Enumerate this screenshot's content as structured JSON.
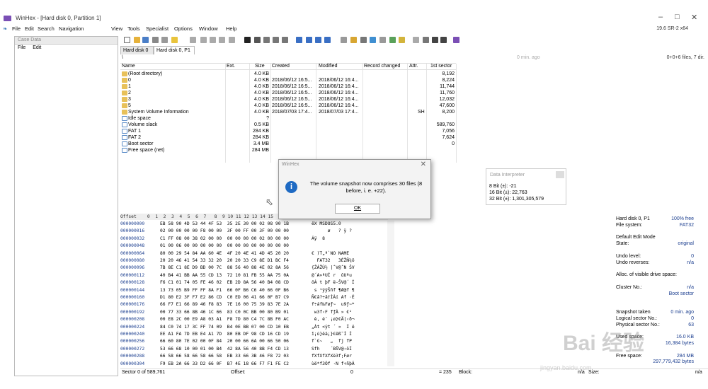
{
  "window": {
    "title": "WinHex - [Hard disk 0, Partition 1]",
    "version": "19.6 SR-2 x64"
  },
  "menu": [
    "File",
    "Edit",
    "Search",
    "Navigation",
    "View",
    "Tools",
    "Specialist",
    "Options",
    "Window",
    "Help"
  ],
  "case": {
    "header": "Case Data",
    "menu": [
      "File",
      "Edit"
    ]
  },
  "tabs": [
    "Hard disk 0",
    "Hard disk 0, P1"
  ],
  "path": {
    "left": "\\",
    "center": "0 min. ago",
    "right": "0+0+6 files, 7 dir."
  },
  "columns": {
    "name": "Name",
    "ext": "Ext.",
    "size": "Size",
    "created": "Created",
    "modified": "Modified",
    "record": "Record changed",
    "attr": "Attr.",
    "sector": "1st sector"
  },
  "files": [
    {
      "name": "(Root directory)",
      "size": "4.0 KB",
      "created": "",
      "modified": "",
      "attr": "",
      "sector": "8,192",
      "icon": "folder"
    },
    {
      "name": "0",
      "size": "4.0 KB",
      "created": "2018/06/12 16:5...",
      "modified": "2018/06/12 16:4...",
      "attr": "",
      "sector": "8,224",
      "icon": "folder"
    },
    {
      "name": "1",
      "size": "4.0 KB",
      "created": "2018/06/12 16:5...",
      "modified": "2018/06/12 16:4...",
      "attr": "",
      "sector": "11,744",
      "icon": "folder"
    },
    {
      "name": "2",
      "size": "4.0 KB",
      "created": "2018/06/12 16:5...",
      "modified": "2018/06/12 16:4...",
      "attr": "",
      "sector": "11,760",
      "icon": "folder"
    },
    {
      "name": "3",
      "size": "4.0 KB",
      "created": "2018/06/12 16:5...",
      "modified": "2018/06/12 16:4...",
      "attr": "",
      "sector": "12,032",
      "icon": "folder"
    },
    {
      "name": "5",
      "size": "4.0 KB",
      "created": "2018/06/12 16:5...",
      "modified": "2018/06/12 16:4...",
      "attr": "",
      "sector": "47,600",
      "icon": "folder"
    },
    {
      "name": "System Volume Information",
      "size": "4.0 KB",
      "created": "2018/07/03 17:4...",
      "modified": "2018/07/03 17:4...",
      "attr": "SH",
      "sector": "8,200",
      "icon": "folder"
    },
    {
      "name": "Idle space",
      "size": "?",
      "created": "",
      "modified": "",
      "attr": "",
      "sector": "",
      "icon": "file"
    },
    {
      "name": "Volume slack",
      "size": "0.5 KB",
      "created": "",
      "modified": "",
      "attr": "",
      "sector": "589,760",
      "icon": "file"
    },
    {
      "name": "FAT 1",
      "size": "284 KB",
      "created": "",
      "modified": "",
      "attr": "",
      "sector": "7,056",
      "icon": "file"
    },
    {
      "name": "FAT 2",
      "size": "284 KB",
      "created": "",
      "modified": "",
      "attr": "",
      "sector": "7,624",
      "icon": "file"
    },
    {
      "name": "Boot sector",
      "size": "3.4 MB",
      "created": "",
      "modified": "",
      "attr": "",
      "sector": "0",
      "icon": "file"
    },
    {
      "name": "Free space (net)",
      "size": "284 MB",
      "created": "",
      "modified": "",
      "attr": "",
      "sector": "",
      "icon": "file"
    }
  ],
  "dialog": {
    "title": "WinHex",
    "message": "The volume snapshot now comprises 30 files (8 before, i. e. +22).",
    "ok": "OK"
  },
  "interpreter": {
    "title": "Data Interpreter",
    "rows": [
      "8 Bit (±): -21",
      "16 Bit (±): 22,763",
      "32 Bit (±): 1,301,305,579"
    ]
  },
  "hex": {
    "header": "Offset    0  1  2  3  4  5  6  7   8  9 10 11 12 13 14 15",
    "rows": [
      {
        "off": "000000000",
        "hex": "EB 58 90 4D 53 44 4F 53  35 2E 30 00 02 08 90 1B",
        "txt": "ëX MSDOS5.0"
      },
      {
        "off": "000000016",
        "hex": "02 00 00 00 00 F8 00 00  3F 00 FF 00 3F 00 00 00",
        "txt": "      ø   ? ÿ ?"
      },
      {
        "off": "000000032",
        "hex": "C1 FF 08 00 38 02 00 00  00 00 00 00 02 00 00 00",
        "txt": "Áÿ  8"
      },
      {
        "off": "000000048",
        "hex": "01 00 06 00 00 00 00 00  00 00 00 00 00 00 00 00",
        "txt": ""
      },
      {
        "off": "000000064",
        "hex": "80 00 29 54 84 AA 60 4E  4F 20 4E 41 4D 45 20 20",
        "txt": "€ )T„ª`NO NAME"
      },
      {
        "off": "000000080",
        "hex": "20 20 46 41 54 33 32 20  20 20 33 C9 8E D1 BC F4",
        "txt": "  FAT32   3ÉŽÑ¼ô"
      },
      {
        "off": "000000096",
        "hex": "7B 8E C1 8E D9 BD 00 7C  88 56 40 88 4E 02 8A 56",
        "txt": "{ŽÁŽÙ½ |ˆV@ˆN ŠV"
      },
      {
        "off": "000000112",
        "hex": "40 B4 41 BB AA 55 CD 13  72 10 81 FB 55 AA 75 0A",
        "txt": "@´A»ªUÍ r  ûUªu"
      },
      {
        "off": "000000128",
        "hex": "F6 C1 01 74 05 FE 46 02  EB 2D 8A 56 40 B4 08 CD",
        "txt": "öÁ t þF ë-ŠV@´ Í"
      },
      {
        "off": "000000144",
        "hex": "13 73 05 B9 FF FF 8A F1  66 0F B6 C6 40 66 0F B6",
        "txt": " s ¹ÿÿŠñf ¶Æ@f ¶"
      },
      {
        "off": "000000160",
        "hex": "D1 80 E2 3F F7 E2 86 CD  C0 ED 06 41 66 0F B7 C9",
        "txt": "Ñ€â?÷â†ÍÀí Af ·É"
      },
      {
        "off": "000000176",
        "hex": "66 F7 E1 66 89 46 F8 83  7E 16 00 75 39 83 7E 2A",
        "txt": "f÷áf‰Føƒ~  u9ƒ~*"
      },
      {
        "off": "000000192",
        "hex": "00 77 33 66 8B 46 1C 66  83 C0 0C BB 00 80 B9 01",
        "txt": " w3f‹F fƒÀ » €¹"
      },
      {
        "off": "000000208",
        "hex": "00 E8 2C 00 E9 A8 03 A1  F8 7D 80 C4 7C 8B F0 AC",
        "txt": " è, é¨ ¡ø}€Ä|‹ð¬"
      },
      {
        "off": "000000224",
        "hex": "84 C0 74 17 3C FF 74 09  B4 0E BB 07 00 CD 10 EB",
        "txt": "„Àt <ÿt ´ »  Í ë"
      },
      {
        "off": "000000240",
        "hex": "EE A1 FA 7D EB E4 A1 7D  80 EB DF 98 CD 16 CD 19",
        "txt": "î¡ú}ëä¡}€ëß˜Í Í"
      },
      {
        "off": "000000256",
        "hex": "66 60 80 7E 02 00 0F 84  20 00 66 6A 00 66 50 06",
        "txt": "f`€~   „  fj fP"
      },
      {
        "off": "000000272",
        "hex": "53 66 68 10 00 01 00 B4  42 8A 56 40 8B F4 CD 13",
        "txt": "Sfh    ´BŠV@‹ôÍ"
      },
      {
        "off": "000000288",
        "hex": "66 58 66 58 66 58 66 58  EB 33 66 3B 46 F8 72 03",
        "txt": "fXfXfXfXë3f;Før"
      },
      {
        "off": "000000304",
        "hex": "F9 EB 2A 66 33 D2 66 0F  B7 4E 18 66 F7 F1 FE C2",
        "txt": "ùë*f3Òf ·N f÷ñþÂ"
      }
    ]
  },
  "rightpanel": [
    {
      "l": "Hard disk 0, P1",
      "r": "100% free"
    },
    {
      "l": "File system:",
      "r": "FAT32"
    },
    {
      "l": "",
      "r": ""
    },
    {
      "l": "Default Edit Mode",
      "r": ""
    },
    {
      "l": "State:",
      "r": "original"
    },
    {
      "l": "",
      "r": ""
    },
    {
      "l": "Undo level:",
      "r": "0"
    },
    {
      "l": "Undo reverses:",
      "r": "n/a"
    },
    {
      "l": "",
      "r": ""
    },
    {
      "l": "Alloc. of visible drive space:",
      "r": ""
    },
    {
      "l": "",
      "r": ""
    },
    {
      "l": "Cluster No.:",
      "r": "n/a"
    },
    {
      "l": "",
      "r": "Boot sector"
    },
    {
      "l": "",
      "r": ""
    },
    {
      "l": "",
      "r": ""
    },
    {
      "l": "Snapshot taken",
      "r": "0 min. ago"
    },
    {
      "l": "Logical sector No.:",
      "r": "0"
    },
    {
      "l": "Physical sector No.:",
      "r": "63"
    },
    {
      "l": "",
      "r": ""
    },
    {
      "l": "Used space:",
      "r": "16.0 KB"
    },
    {
      "l": "",
      "r": "16,384 bytes"
    },
    {
      "l": "",
      "r": ""
    },
    {
      "l": "Free space:",
      "r": "284 MB"
    },
    {
      "l": "",
      "r": "297,779,432 bytes"
    }
  ],
  "status": {
    "sector": "Sector 0 of 589,761",
    "offset": "Offset:",
    "offset_val": "0",
    "eq": "= 235",
    "block": "Block:",
    "block_val": "n/a",
    "size": "Size:",
    "size_val": "n/a"
  },
  "watermark": {
    "main": "Bai 经验",
    "url": "jingyan.baidu.com"
  }
}
